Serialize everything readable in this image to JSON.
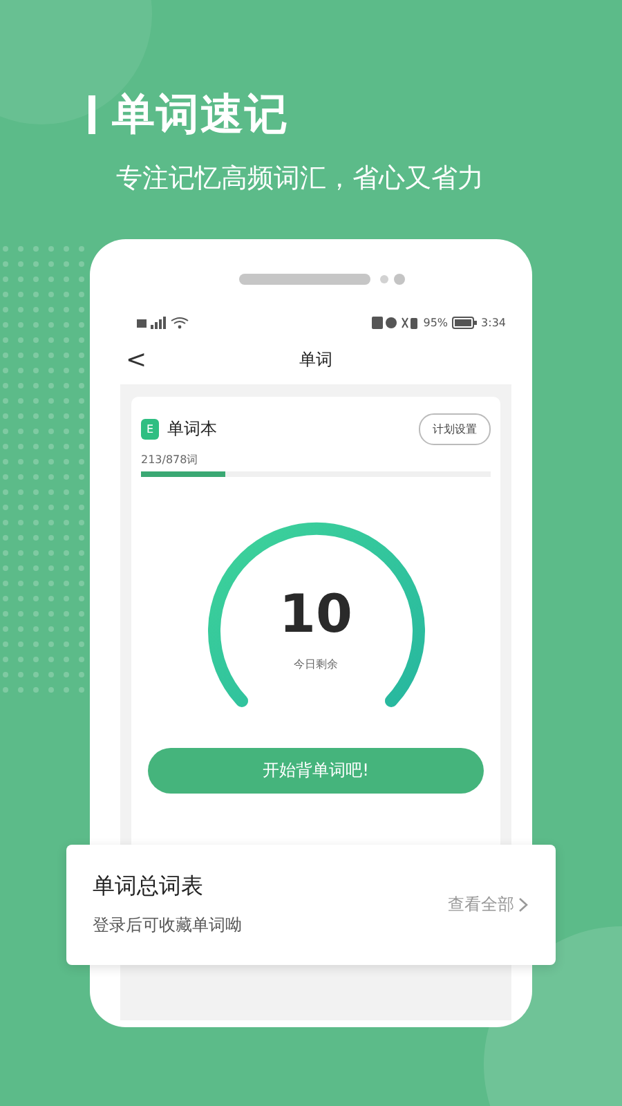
{
  "headline": "单词速记",
  "subtitle": "专注记忆高频词汇，省心又省力",
  "status_bar": {
    "battery": "95%",
    "time": "3:34"
  },
  "nav": {
    "back": "<",
    "title": "单词"
  },
  "book": {
    "badge": "E",
    "name": "单词本",
    "plan_button": "计划设置",
    "progress_text": "213/878词",
    "level": 0.24
  },
  "gauge": {
    "count": "10",
    "caption": "今日剩余"
  },
  "start_button": "开始背单词吧!",
  "word_list_card": {
    "title": "单词总词表",
    "hint": "登录后可收藏单词呦",
    "link": "查看全部"
  }
}
